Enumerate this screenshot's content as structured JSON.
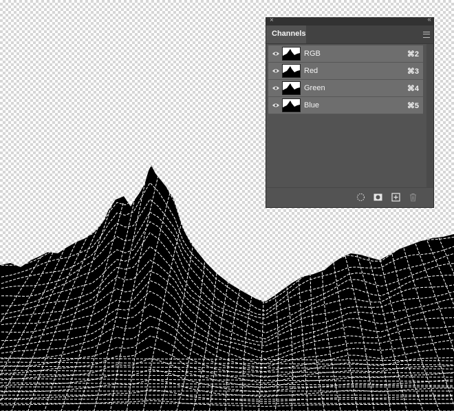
{
  "panel": {
    "close_glyph": "×",
    "collapse_glyph": "‹‹",
    "tab_label": "Channels",
    "menu_icon": "panel-menu-icon",
    "channels": [
      {
        "name": "RGB",
        "shortcut": "⌘2",
        "icon": "eye-icon"
      },
      {
        "name": "Red",
        "shortcut": "⌘3",
        "icon": "eye-icon"
      },
      {
        "name": "Green",
        "shortcut": "⌘4",
        "icon": "eye-icon"
      },
      {
        "name": "Blue",
        "shortcut": "⌘5",
        "icon": "eye-icon"
      }
    ],
    "footer_icons": [
      "load-selection-icon",
      "save-selection-mask-icon",
      "new-channel-icon",
      "delete-channel-icon"
    ]
  },
  "canvas": {
    "content": "wireframe-mountain-artwork",
    "colors": {
      "fill": "#000000",
      "wire": "#ffffff",
      "checker_light": "#ffffff",
      "checker_dark": "#d6d6d6",
      "panel_bg": "#535353",
      "row_bg": "#6e6e6e"
    }
  }
}
